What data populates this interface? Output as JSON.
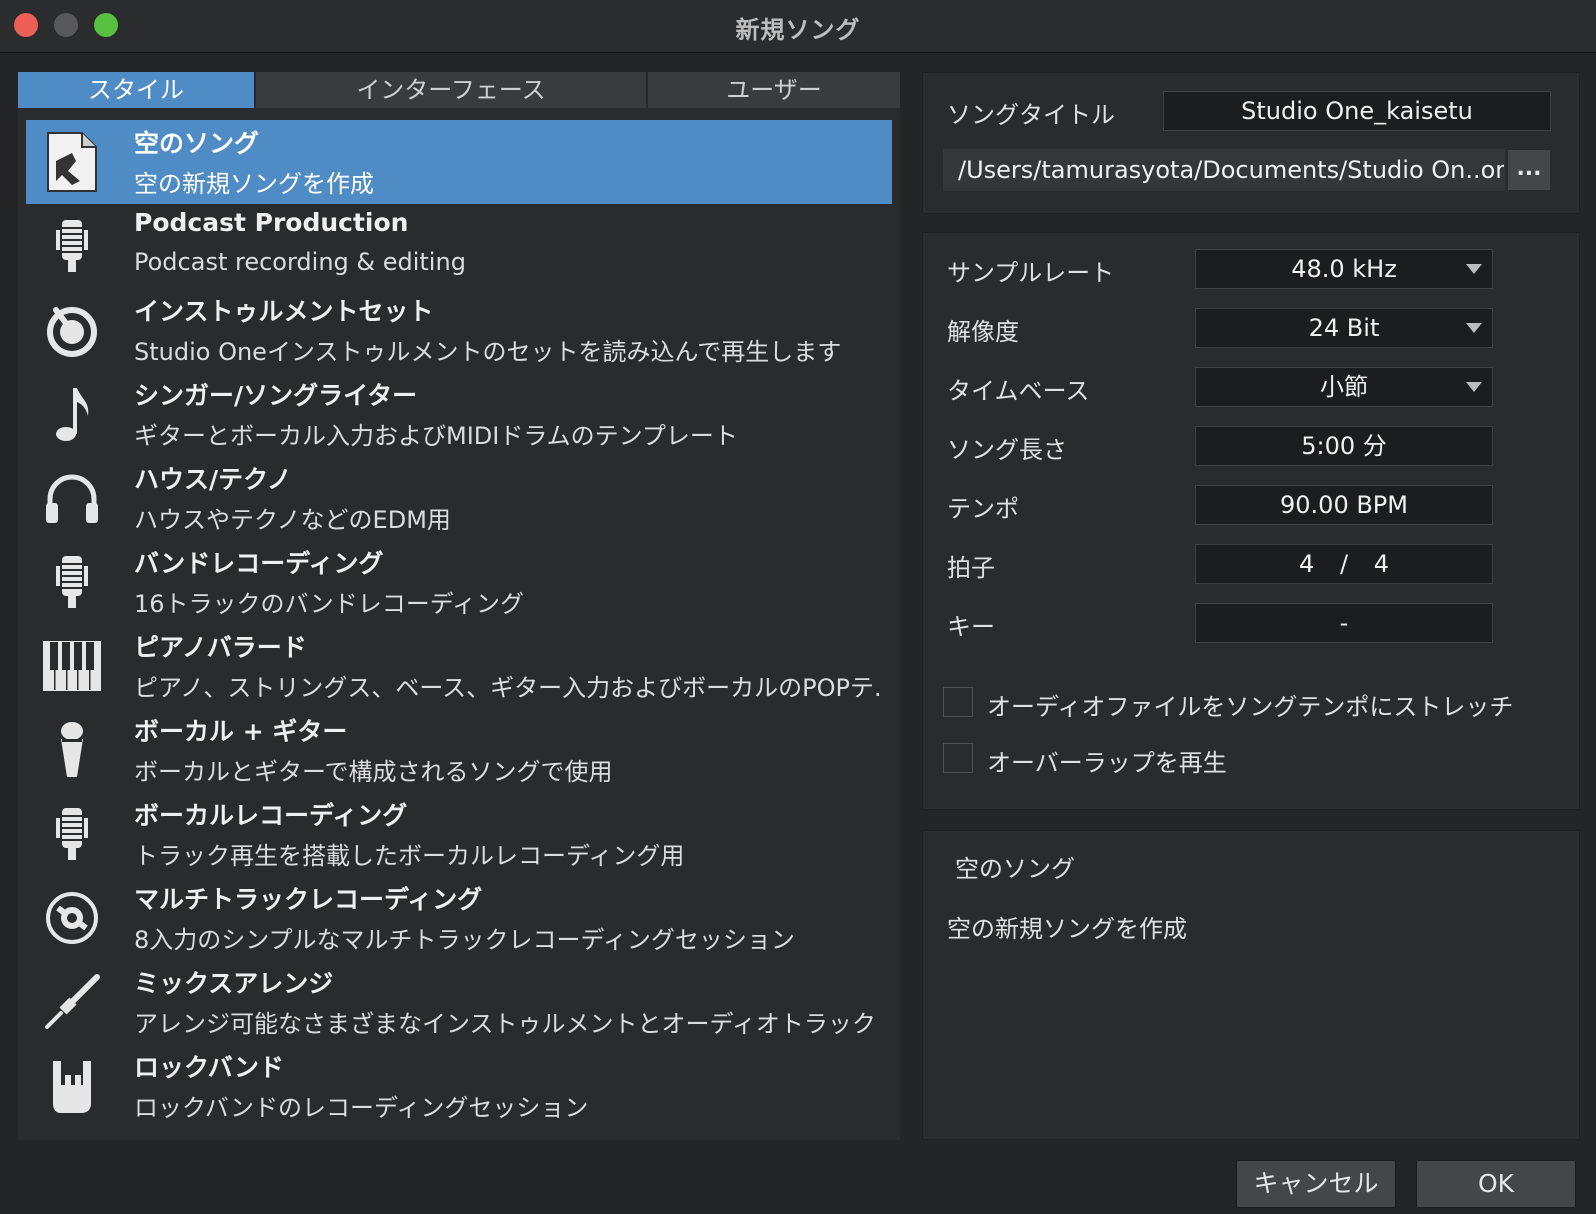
{
  "window": {
    "title": "新規ソング"
  },
  "tabs": [
    {
      "label": "スタイル",
      "active": true
    },
    {
      "label": "インターフェース",
      "active": false
    },
    {
      "label": "ユーザー",
      "active": false
    }
  ],
  "templates": [
    {
      "title": "空のソング",
      "subtitle": "空の新規ソングを作成",
      "icon": "empty-song-icon",
      "selected": true
    },
    {
      "title": "Podcast Production",
      "subtitle": "Podcast recording & editing",
      "icon": "microphone-icon"
    },
    {
      "title": "インストゥルメントセット",
      "subtitle": "Studio Oneインストゥルメントのセットを読み込んで再生します",
      "icon": "knob-icon"
    },
    {
      "title": "シンガー/ソングライター",
      "subtitle": "ギターとボーカル入力およびMIDIドラムのテンプレート",
      "icon": "music-note-icon"
    },
    {
      "title": "ハウス/テクノ",
      "subtitle": "ハウスやテクノなどのEDM用",
      "icon": "headphones-icon"
    },
    {
      "title": "バンドレコーディング",
      "subtitle": "16トラックのバンドレコーディング",
      "icon": "microphone-icon"
    },
    {
      "title": "ピアノバラード",
      "subtitle": "ピアノ、ストリングス、ベース、ギター入力およびボーカルのPOPテ..",
      "icon": "piano-keys-icon"
    },
    {
      "title": "ボーカル + ギター",
      "subtitle": "ボーカルとギターで構成されるソングで使用",
      "icon": "handheld-mic-icon"
    },
    {
      "title": "ボーカルレコーディング",
      "subtitle": "トラック再生を搭載したボーカルレコーディング用",
      "icon": "microphone-icon"
    },
    {
      "title": "マルチトラックレコーディング",
      "subtitle": "8入力のシンプルなマルチトラックレコーディングセッション",
      "icon": "disc-icon"
    },
    {
      "title": "ミックスアレンジ",
      "subtitle": "アレンジ可能なさまざまなインストゥルメントとオーディオトラック",
      "icon": "jack-plug-icon"
    },
    {
      "title": "ロックバンド",
      "subtitle": "ロックバンドのレコーディングセッション",
      "icon": "rock-hand-icon"
    }
  ],
  "song": {
    "title_label": "ソングタイトル",
    "title_value": "Studio One_kaisetu",
    "path_value": "/Users/tamurasyota/Documents/Studio On..ongs",
    "browse_label": "..."
  },
  "settings": {
    "sample_rate_label": "サンプルレート",
    "sample_rate_value": "48.0 kHz",
    "resolution_label": "解像度",
    "resolution_value": "24 Bit",
    "timebase_label": "タイムベース",
    "timebase_value": "小節",
    "length_label": "ソング長さ",
    "length_value": "5:00 分",
    "tempo_label": "テンポ",
    "tempo_value": "90.00 BPM",
    "signature_label": "拍子",
    "signature_num": "4",
    "signature_sep": "/",
    "signature_den": "4",
    "key_label": "キー",
    "key_value": "-",
    "stretch_label": "オーディオファイルをソングテンポにストレッチ",
    "stretch_checked": false,
    "overlap_label": "オーバーラップを再生",
    "overlap_checked": false
  },
  "description": {
    "title": "空のソング",
    "text": "空の新規ソングを作成"
  },
  "buttons": {
    "cancel": "キャンセル",
    "ok": "OK"
  }
}
